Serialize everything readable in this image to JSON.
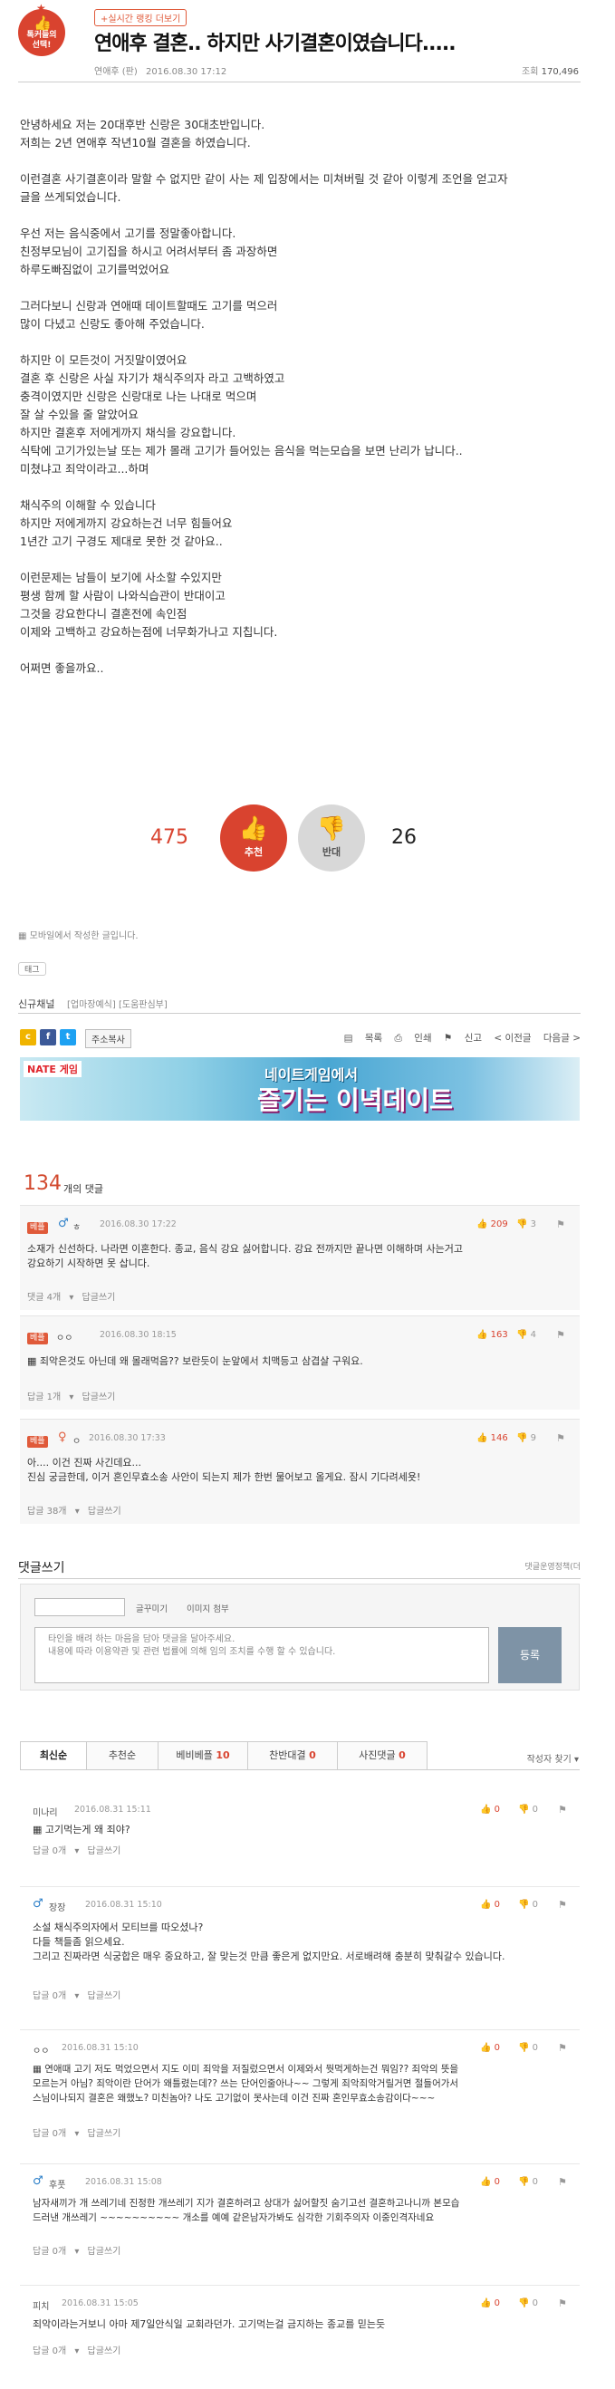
{
  "header": {
    "badge_label_1": "톡커들의",
    "badge_label_2": "선택!",
    "realtime_btn": "+실시간 랭킹 더보기",
    "title": "연애후 결혼.. 하지만 사기결혼이였습니다.....",
    "author": "연애후 (판)",
    "date": "2016.08.30 17:12",
    "views_label": "조회",
    "views": "170,496"
  },
  "content": [
    "안녕하세요 저는 20대후반 신랑은 30대초반입니다.",
    "저희는 2년 연애후 작년10월 결혼을 하였습니다.",
    "",
    "이런결혼 사기결혼이라 말할 수 없지만 같이 사는 제 입장에서는 미쳐버릴 것 같아 이렇게 조언을 얻고자",
    "글을 쓰게되었습니다.",
    "",
    "우선 저는 음식중에서 고기를 정말좋아합니다.",
    "친정부모님이 고기집을 하시고 어려서부터 좀 과장하면",
    "하루도빠짐없이 고기를먹었어요",
    "",
    "그러다보니 신랑과 연애때 데이트할때도 고기를 먹으러",
    "많이 다녔고 신랑도 좋아해 주었습니다.",
    "",
    "하지만 이 모든것이 거짓말이였어요",
    "결혼 후 신랑은 사실 자기가 채식주의자 라고 고백하였고",
    "충격이였지만 신랑은 신랑대로 나는 나대로 먹으며",
    "잘 살 수있을 줄 알았어요",
    "하지만 결혼후 저에게까지 채식을 강요합니다.",
    "식탁에 고기가있는날 또는 제가 몰래 고기가 들어있는 음식을 먹는모습을 보면 난리가 납니다..",
    "미쳤냐고 죄악이라고...하며",
    "",
    "채식주의 이해할 수 있습니다",
    "하지만 저에게까지 강요하는건 너무 힘들어요",
    "1년간 고기 구경도 제대로 못한 것 같아요..",
    "",
    "이런문제는 남들이 보기에 사소할 수있지만",
    "평생 함께 할 사람이 나와식습관이 반대이고",
    "그것을 강요한다니 결혼전에 속인점",
    "이제와 고백하고 강요하는점에 너무화가나고 지칩니다.",
    "",
    "어쩌면 좋을까요.."
  ],
  "votes": {
    "up_count": "475",
    "up_label": "추천",
    "down_count": "26",
    "down_label": "반대",
    "up_color": "#d9432f",
    "down_color": "#d8d8d8"
  },
  "mobile_note": "모바일에서 작성한 글입니다.",
  "tag_label": "태그",
  "channel": {
    "label": "신규채널",
    "links": "[업마장예식] [도움판심부]"
  },
  "toolbar": {
    "copy": "주소복사",
    "list": "목록",
    "print": "인쇄",
    "report": "신고",
    "prev": "< 이전글",
    "next": "다음글 >"
  },
  "banner": {
    "logo": "NATE 게임",
    "line1": "네이트게임에서",
    "line2": "즐기는 이녁데이트"
  },
  "comments_header": {
    "count": "134",
    "label": "개의 댓글"
  },
  "best_comments": [
    {
      "tag": "베플",
      "nick": "ㅎ",
      "date": "2016.08.30 17:22",
      "up": "209",
      "down": "3",
      "text_1": "소재가 신선하다. 나라면 이혼한다. 종교, 음식 강요 싫어합니다. 강요 전까지만 끝나면 이해하며 사는거고",
      "text_2": "강요하기 시작하면 못 삽니다.",
      "reply_count": "댓글 4개",
      "reply_write": "답글쓰기"
    },
    {
      "tag": "베플",
      "nick": "ㅇㅇ",
      "date": "2016.08.30 18:15",
      "up": "163",
      "down": "4",
      "text_1": "죄악은것도 아닌데 왜 몰래먹음?? 보란듯이 눈앞에서 치맥등고 삼겹살 구워요.",
      "text_2": "",
      "reply_count": "답글 1개",
      "reply_write": "답글쓰기"
    },
    {
      "tag": "베플",
      "nick": "ㅇ",
      "date": "2016.08.30 17:33",
      "up": "146",
      "down": "9",
      "text_1": "아.... 이건 진짜 사긴데요...",
      "text_2": "진심 궁금한데, 이거 혼인무효소송 사안이 되는지 제가 한번 물어보고 올게요. 잠시 기다려세욧!",
      "reply_count": "답글 38개",
      "reply_write": "답글쓰기"
    }
  ],
  "write": {
    "title": "댓글쓰기",
    "policy": "댓글운영정책(더",
    "opt1": "글꾸미기",
    "opt2": "이미지 첨부",
    "placeholder_1": "타인을 배려 하는 마음을 담아 댓글을 달아주세요.",
    "placeholder_2": "내용에 따라 이용약관 및 관련 법률에 의해 임의 조치를 수행 할 수 있습니다.",
    "submit": "등록"
  },
  "tabs": [
    {
      "label": "최신순",
      "count": ""
    },
    {
      "label": "추천순",
      "count": ""
    },
    {
      "label": "베비베플",
      "count": "10"
    },
    {
      "label": "찬반대결",
      "count": "0"
    },
    {
      "label": "사진댓글",
      "count": "0"
    }
  ],
  "sort_link": "작성자 찾기",
  "comments": [
    {
      "nick": "미나리",
      "date": "2016.08.31 15:11",
      "up": "0",
      "down": "0",
      "text_1": "고기먹는게 왜 죄야?",
      "text_2": "",
      "text_3": "",
      "reply_count": "답글 0개",
      "reply_write": "답글쓰기"
    },
    {
      "nick": "장장",
      "date": "2016.08.31 15:10",
      "up": "0",
      "down": "0",
      "text_1": "소설 채식주의자에서 모티브를 따오셨나?",
      "text_2": "다들 책들좀 읽으세요.",
      "text_3": "그리고 진짜라면 식궁합은 매우 중요하고, 잘 맞는것 만큼 좋은게 없지만요. 서로배려해 충분히 맞춰갈수 있습니다.",
      "reply_count": "답글 0개",
      "reply_write": "답글쓰기"
    },
    {
      "nick": "ㅇㅇ",
      "date": "2016.08.31 15:10",
      "up": "0",
      "down": "0",
      "text_1": "연애때 고기 저도 먹었으면서 지도 이미 죄악을 저질렀으면서 이제와서 뭣먹게하는건 뭐임?? 죄악의 뜻을",
      "text_2": "모르는거 아님? 죄악이란 단어가 왜틀렸는데?? 쓰는 단어인줄아나~~ 그렇게 죄악죄악거릴거면 절들어가서",
      "text_3": "스님이나되지 결혼은 왜했노? 미친놈아? 나도 고기없이 못사는데 이건 진짜 혼인무효소송감이다~~~",
      "reply_count": "답글 0개",
      "reply_write": "답글쓰기"
    },
    {
      "nick": "후풋",
      "date": "2016.08.31 15:08",
      "up": "0",
      "down": "0",
      "text_1": "남자새끼가 개 쓰레기네 진정한 개쓰레기 지가 결혼하려고 상대가 싫어할짓 숨기고선 결혼하고나니까 본모습",
      "text_2": "드러낸 개쓰레기 ~~~~~~~~~~ 개소를 예예 같은남자가봐도 심각한 기회주의자 이중인격자네요",
      "text_3": "",
      "reply_count": "답글 0개",
      "reply_write": "답글쓰기"
    },
    {
      "nick": "피치",
      "date": "2016.08.31 15:05",
      "up": "0",
      "down": "0",
      "text_1": "죄악이라는거보니 아마 제7일안식일 교회라던가. 고기먹는걸 금지하는 종교를 믿는듯",
      "text_2": "",
      "text_3": "",
      "reply_count": "답글 0개",
      "reply_write": "답글쓰기"
    }
  ]
}
